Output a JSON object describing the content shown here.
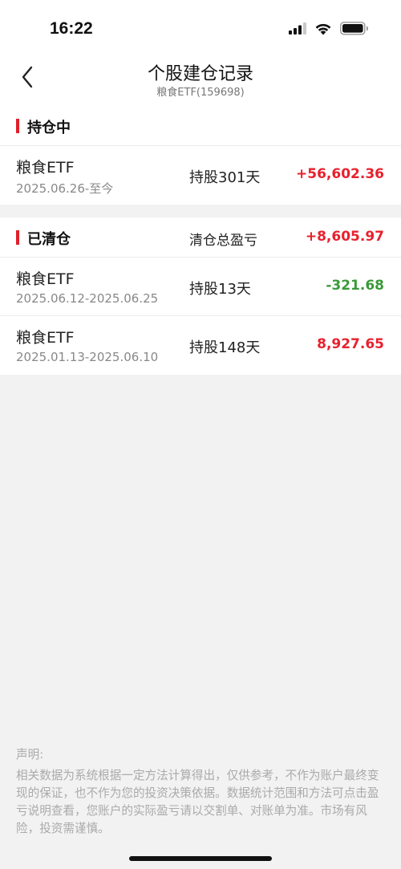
{
  "status_bar": {
    "time": "16:22"
  },
  "nav": {
    "title": "个股建仓记录",
    "subtitle": "粮食ETF(159698)"
  },
  "holding": {
    "title": "持仓中",
    "rows": [
      {
        "name": "粮食ETF",
        "date": "2025.06.26-至今",
        "hold": "持股301天",
        "pnl": "+56,602.36",
        "pnl_color": "red"
      }
    ]
  },
  "closed": {
    "title": "已清仓",
    "total_label": "清仓总盈亏",
    "total_value": "+8,605.97",
    "rows": [
      {
        "name": "粮食ETF",
        "date": "2025.06.12-2025.06.25",
        "hold": "持股13天",
        "pnl": "-321.68",
        "pnl_color": "green"
      },
      {
        "name": "粮食ETF",
        "date": "2025.01.13-2025.06.10",
        "hold": "持股148天",
        "pnl": "8,927.65",
        "pnl_color": "red"
      }
    ]
  },
  "disclaimer": {
    "title": "声明:",
    "body": "相关数据为系统根据一定方法计算得出，仅供参考，不作为账户最终变现的保证，也不作为您的投资决策依据。数据统计范围和方法可点击盈亏说明查看，您账户的实际盈亏请以交割单、对账单为准。市场有风险，投资需谨慎。"
  },
  "colors": {
    "accent_red": "#e8212e",
    "loss_green": "#3a9a3a",
    "section_bar": "#e0202a"
  },
  "icons": [
    "cellular-signal-icon",
    "wifi-icon",
    "battery-icon",
    "back-chevron-icon"
  ]
}
